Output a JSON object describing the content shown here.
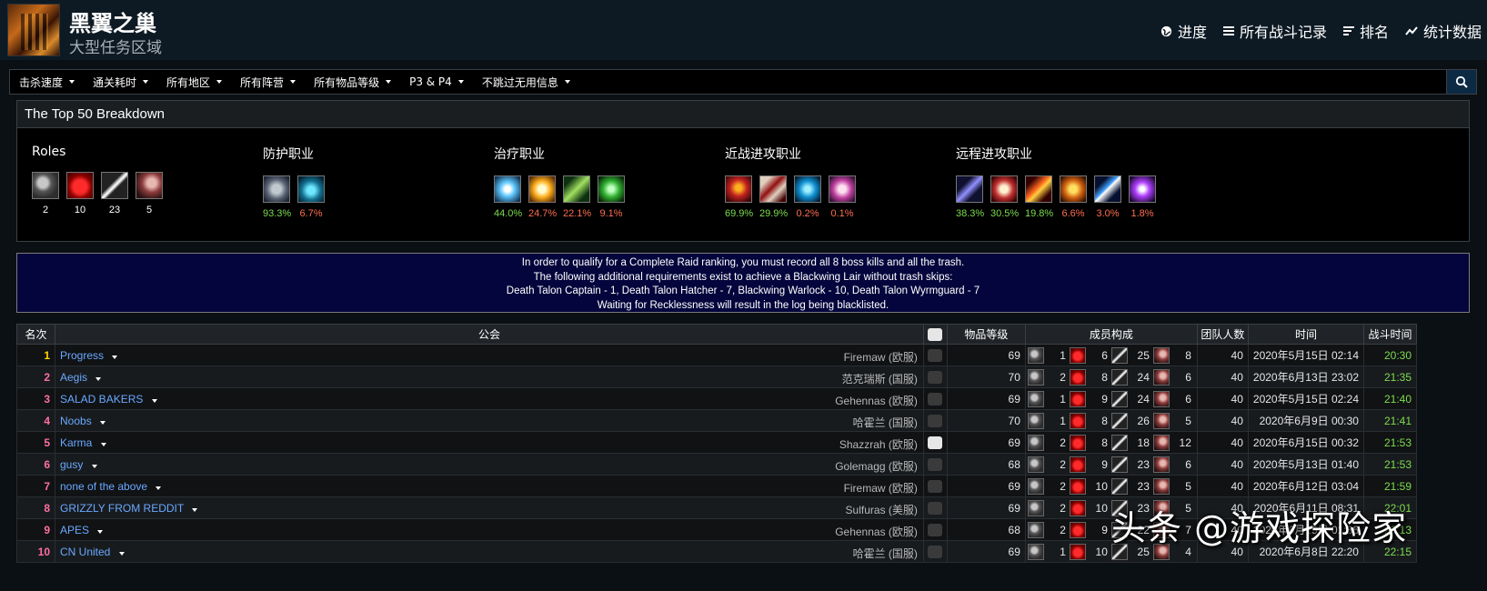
{
  "header": {
    "title": "黑翼之巢",
    "subtitle": "大型任务区域",
    "links": [
      {
        "icon": "globe-icon",
        "label": "进度"
      },
      {
        "icon": "list-icon",
        "label": "所有战斗记录"
      },
      {
        "icon": "rankings-icon",
        "label": "排名"
      },
      {
        "icon": "stats-icon",
        "label": "统计数据"
      }
    ]
  },
  "nav": {
    "items": [
      "击杀速度",
      "通关耗时",
      "所有地区",
      "所有阵营",
      "所有物品等级",
      "P3 & P4",
      "不跳过无用信息"
    ]
  },
  "breakdown": {
    "title": "The Top 50 Breakdown",
    "groups": [
      {
        "title": "Roles",
        "items": [
          {
            "icon": "tank-role-icon",
            "value": "2",
            "tone": "wht"
          },
          {
            "icon": "healer-role-icon",
            "value": "10",
            "tone": "wht"
          },
          {
            "icon": "melee-role-icon",
            "value": "23",
            "tone": "wht"
          },
          {
            "icon": "ranged-role-icon",
            "value": "5",
            "tone": "wht"
          }
        ]
      },
      {
        "title": "防护职业",
        "items": [
          {
            "icon": "protection-warrior-icon",
            "value": "93.3%",
            "tone": "pos"
          },
          {
            "icon": "feral-tank-icon",
            "value": "6.7%",
            "tone": "neg"
          }
        ]
      },
      {
        "title": "治疗职业",
        "items": [
          {
            "icon": "holy-paladin-icon",
            "value": "44.0%",
            "tone": "pos"
          },
          {
            "icon": "holy-priest-icon",
            "value": "24.7%",
            "tone": "neg"
          },
          {
            "icon": "restoration-druid-icon",
            "value": "22.1%",
            "tone": "neg"
          },
          {
            "icon": "restoration-shaman-icon",
            "value": "9.1%",
            "tone": "neg"
          }
        ]
      },
      {
        "title": "近战进攻职业",
        "items": [
          {
            "icon": "fury-warrior-icon",
            "value": "69.9%",
            "tone": "pos"
          },
          {
            "icon": "rogue-icon",
            "value": "29.9%",
            "tone": "pos"
          },
          {
            "icon": "feral-dps-icon",
            "value": "0.2%",
            "tone": "neg"
          },
          {
            "icon": "retribution-icon",
            "value": "0.1%",
            "tone": "neg"
          }
        ]
      },
      {
        "title": "远程进攻职业",
        "items": [
          {
            "icon": "hunter-icon",
            "value": "38.3%",
            "tone": "pos"
          },
          {
            "icon": "mage-icon",
            "value": "30.5%",
            "tone": "pos"
          },
          {
            "icon": "fire-mage-icon",
            "value": "19.8%",
            "tone": "pos"
          },
          {
            "icon": "warlock-icon",
            "value": "6.6%",
            "tone": "neg"
          },
          {
            "icon": "elemental-icon",
            "value": "3.0%",
            "tone": "neg"
          },
          {
            "icon": "shadow-priest-icon",
            "value": "1.8%",
            "tone": "neg"
          }
        ]
      }
    ]
  },
  "notice": {
    "lines": [
      "In order to qualify for a Complete Raid ranking, you must record all 8 boss kills and all the trash.",
      "The following additional requirements exist to achieve a Blackwing Lair without trash skips:",
      "Death Talon Captain - 1, Death Talon Hatcher - 7, Blackwing Warlock - 10, Death Talon Wyrmguard - 7",
      "Waiting for Recklessness will result in the log being blacklisted."
    ]
  },
  "table": {
    "headers": {
      "rank": "名次",
      "guild": "公会",
      "ilvl": "物品等级",
      "comp": "成员构成",
      "size": "团队人数",
      "time": "时间",
      "duration": "战斗时间"
    },
    "rows": [
      {
        "rank": "1",
        "guild": "Progress",
        "server": "Firemaw (欧服)",
        "yt": false,
        "ilvl": "69",
        "comp": [
          "1",
          "6",
          "25",
          "8"
        ],
        "size": "40",
        "time": "2020年5月15日 02:14",
        "duration": "20:30"
      },
      {
        "rank": "2",
        "guild": "Aegis",
        "server": "范克瑞斯 (国服)",
        "yt": false,
        "ilvl": "70",
        "comp": [
          "2",
          "8",
          "24",
          "6"
        ],
        "size": "40",
        "time": "2020年6月13日 23:02",
        "duration": "21:35"
      },
      {
        "rank": "3",
        "guild": "SALAD BAKERS",
        "server": "Gehennas (欧服)",
        "yt": false,
        "ilvl": "69",
        "comp": [
          "1",
          "9",
          "24",
          "6"
        ],
        "size": "40",
        "time": "2020年5月15日 02:24",
        "duration": "21:40"
      },
      {
        "rank": "4",
        "guild": "Noobs",
        "server": "哈霍兰 (国服)",
        "yt": false,
        "ilvl": "70",
        "comp": [
          "1",
          "8",
          "26",
          "5"
        ],
        "size": "40",
        "time": "2020年6月9日 00:30",
        "duration": "21:41"
      },
      {
        "rank": "5",
        "guild": "Karma",
        "server": "Shazzrah (欧服)",
        "yt": true,
        "ilvl": "69",
        "comp": [
          "2",
          "8",
          "18",
          "12"
        ],
        "size": "40",
        "time": "2020年6月15日 00:32",
        "duration": "21:53"
      },
      {
        "rank": "6",
        "guild": "gusy",
        "server": "Golemagg (欧服)",
        "yt": false,
        "ilvl": "68",
        "comp": [
          "2",
          "9",
          "23",
          "6"
        ],
        "size": "40",
        "time": "2020年5月13日 01:40",
        "duration": "21:53"
      },
      {
        "rank": "7",
        "guild": "none of the above",
        "server": "Firemaw (欧服)",
        "yt": false,
        "ilvl": "69",
        "comp": [
          "2",
          "10",
          "23",
          "5"
        ],
        "size": "40",
        "time": "2020年6月12日 03:04",
        "duration": "21:59"
      },
      {
        "rank": "8",
        "guild": "GRIZZLY FROM REDDIT",
        "server": "Sulfuras (美服)",
        "yt": false,
        "ilvl": "69",
        "comp": [
          "2",
          "10",
          "23",
          "5"
        ],
        "size": "40",
        "time": "2020年6月11日 08:31",
        "duration": "22:01"
      },
      {
        "rank": "9",
        "guild": "APES",
        "server": "Gehennas (欧服)",
        "yt": false,
        "ilvl": "68",
        "comp": [
          "2",
          "9",
          "22",
          "7"
        ],
        "size": "40",
        "time": "2020年6月15日 01:36",
        "duration": "22:13"
      },
      {
        "rank": "10",
        "guild": "CN United",
        "server": "哈霍兰 (国服)",
        "yt": false,
        "ilvl": "69",
        "comp": [
          "1",
          "10",
          "25",
          "4"
        ],
        "size": "40",
        "time": "2020年6月8日 22:20",
        "duration": "22:15"
      }
    ]
  },
  "watermark": "头条 @游戏探险家"
}
